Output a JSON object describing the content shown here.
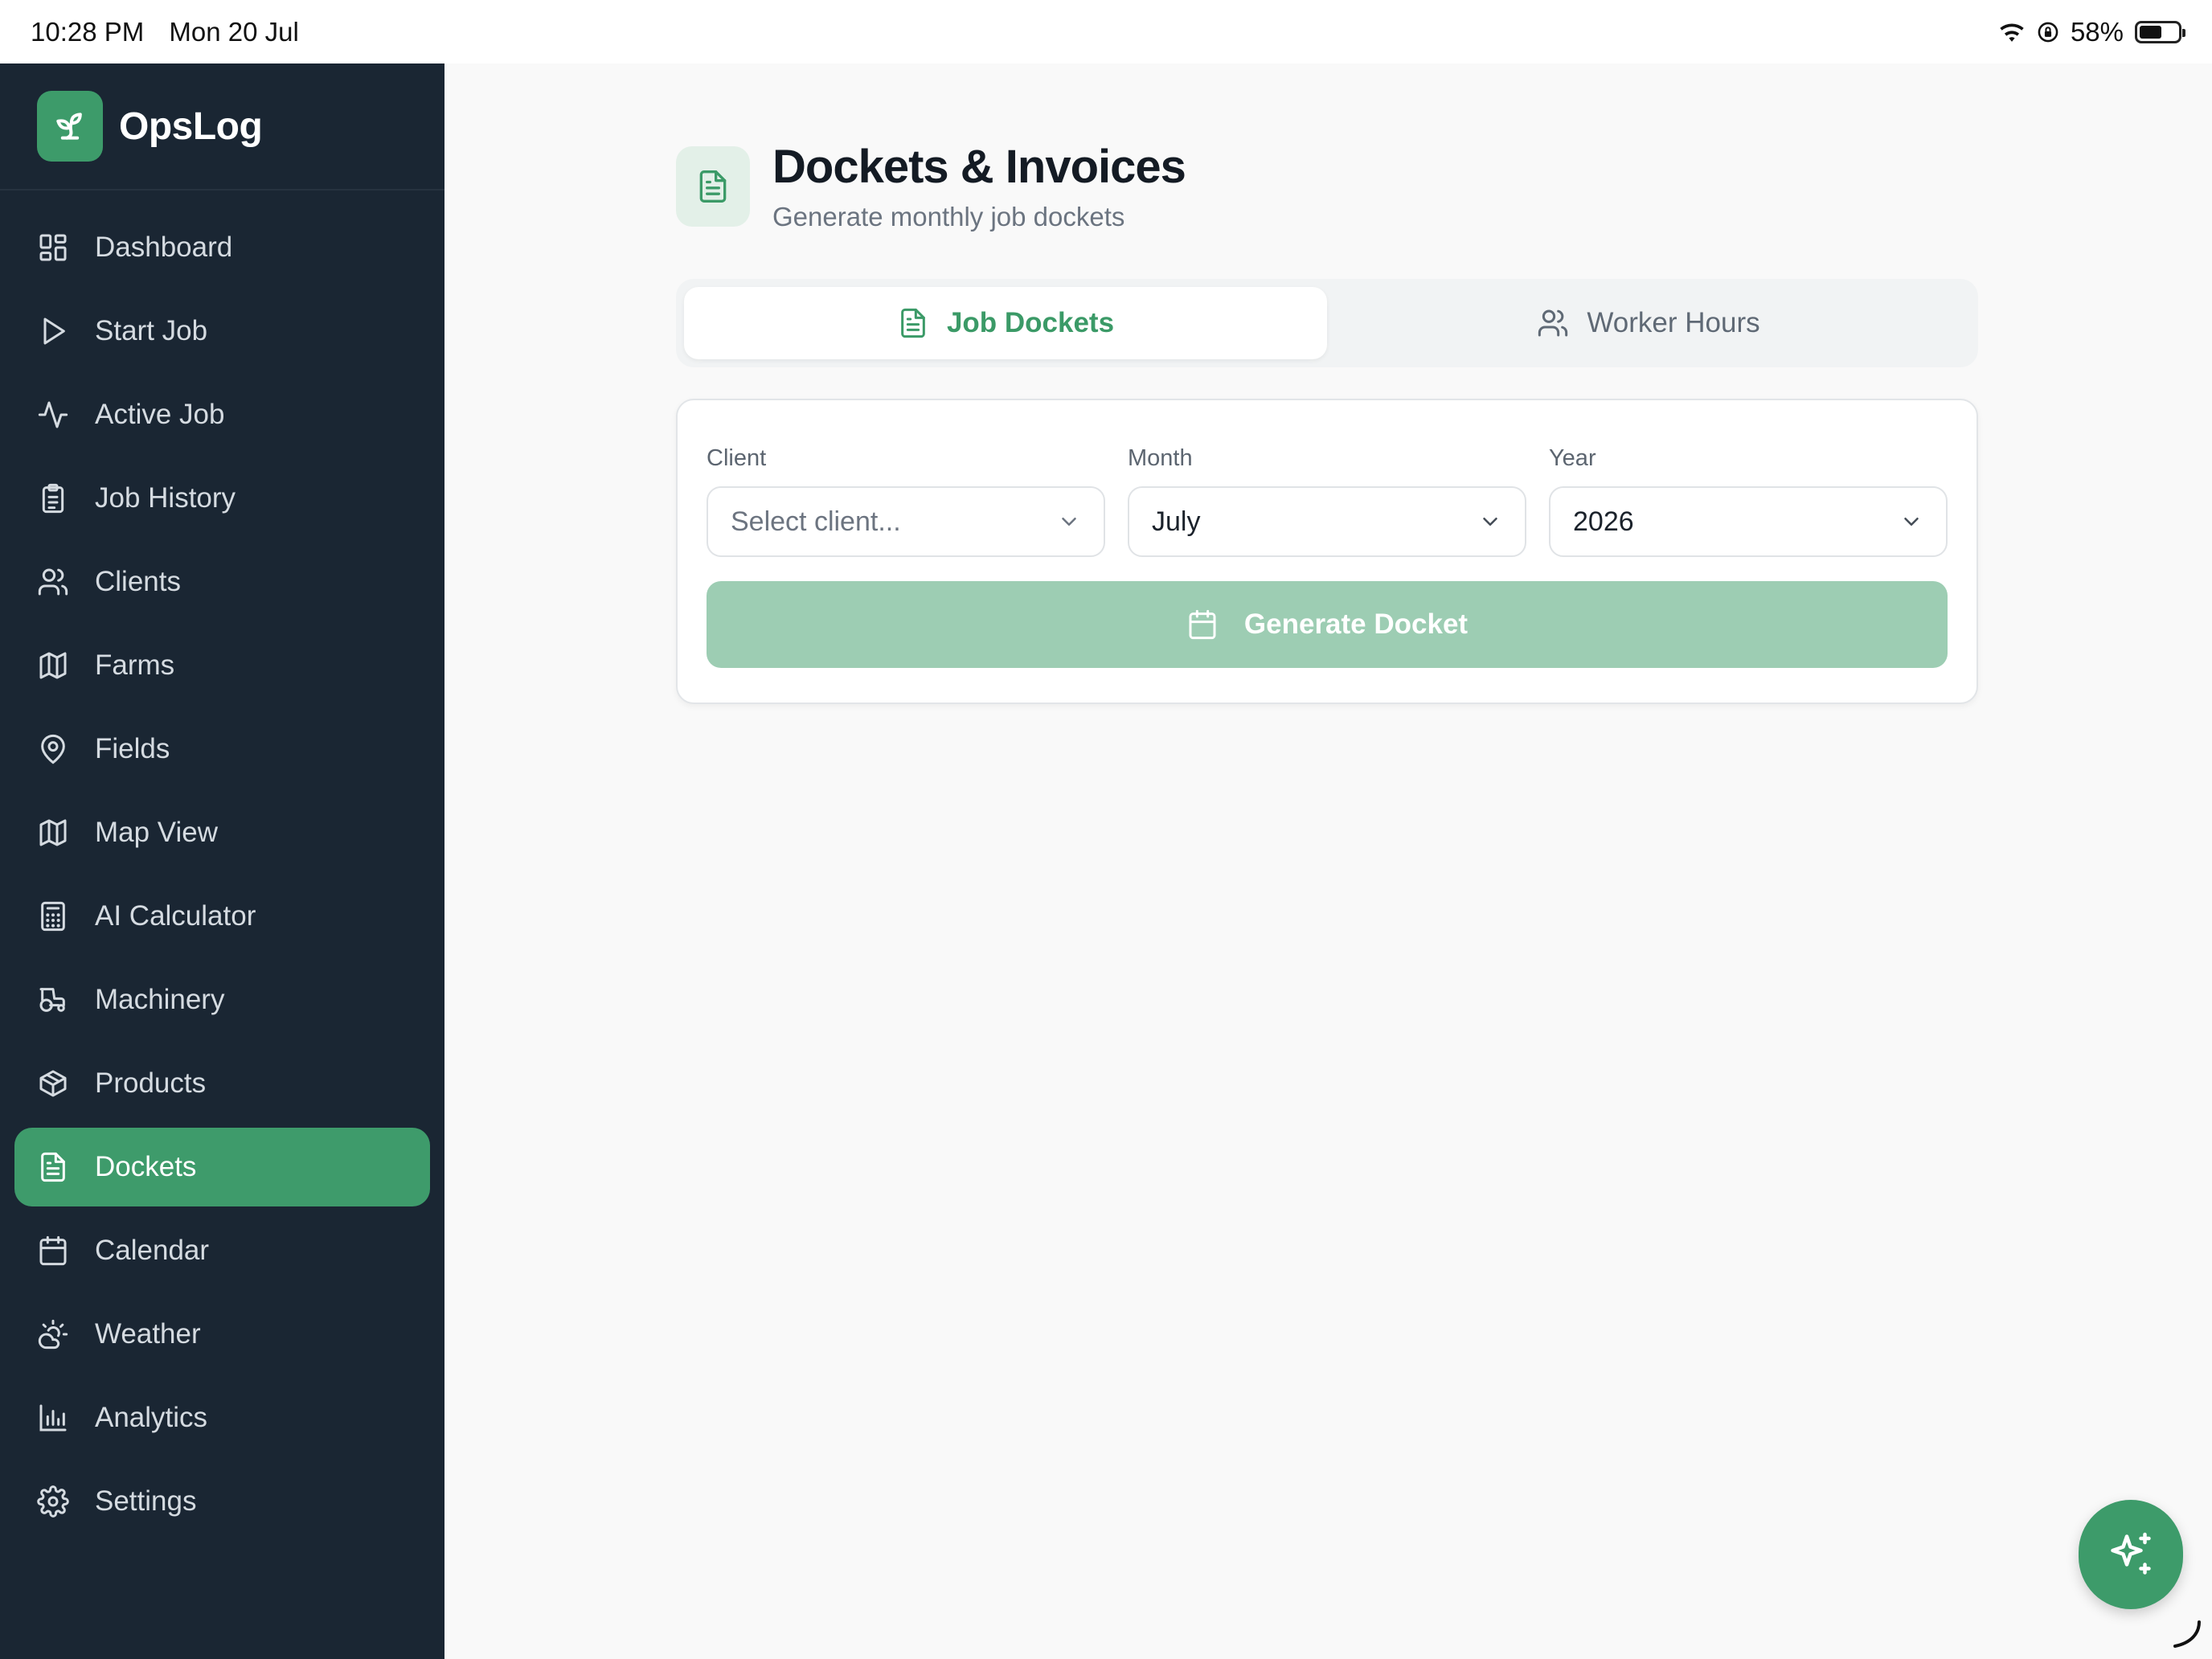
{
  "status_bar": {
    "time": "10:28 PM",
    "date": "Mon 20 Jul",
    "battery": "58%",
    "icons": [
      "wifi-icon",
      "orientation-lock-icon",
      "battery-icon"
    ]
  },
  "app": {
    "name": "OpsLog",
    "logo_icon": "sprout-icon",
    "accent_color": "#3e9b6b",
    "sidebar_color": "#1a2633"
  },
  "sidebar": {
    "items": [
      {
        "label": "Dashboard",
        "icon": "dashboard-grid-icon"
      },
      {
        "label": "Start Job",
        "icon": "play-icon"
      },
      {
        "label": "Active Job",
        "icon": "activity-icon"
      },
      {
        "label": "Job History",
        "icon": "clipboard-list-icon"
      },
      {
        "label": "Clients",
        "icon": "users-icon"
      },
      {
        "label": "Farms",
        "icon": "map-icon"
      },
      {
        "label": "Fields",
        "icon": "map-pin-icon"
      },
      {
        "label": "Map View",
        "icon": "map-icon"
      },
      {
        "label": "AI Calculator",
        "icon": "calculator-icon"
      },
      {
        "label": "Machinery",
        "icon": "tractor-icon"
      },
      {
        "label": "Products",
        "icon": "package-icon"
      },
      {
        "label": "Dockets",
        "icon": "file-text-icon",
        "active": true
      },
      {
        "label": "Calendar",
        "icon": "calendar-icon"
      },
      {
        "label": "Weather",
        "icon": "sun-cloud-icon"
      },
      {
        "label": "Analytics",
        "icon": "bar-chart-icon"
      },
      {
        "label": "Settings",
        "icon": "gear-icon"
      }
    ]
  },
  "page": {
    "title": "Dockets & Invoices",
    "subtitle": "Generate monthly job dockets",
    "icon": "file-text-icon"
  },
  "tabs": [
    {
      "label": "Job Dockets",
      "icon": "file-text-icon",
      "active": true
    },
    {
      "label": "Worker Hours",
      "icon": "users-icon",
      "active": false
    }
  ],
  "form": {
    "client": {
      "label": "Client",
      "placeholder": "Select client..."
    },
    "month": {
      "label": "Month",
      "value": "July"
    },
    "year": {
      "label": "Year",
      "value": "2026"
    },
    "generate_label": "Generate Docket",
    "generate_icon": "calendar-icon",
    "generate_enabled": false
  },
  "fab": {
    "icon": "sparkles-icon"
  }
}
